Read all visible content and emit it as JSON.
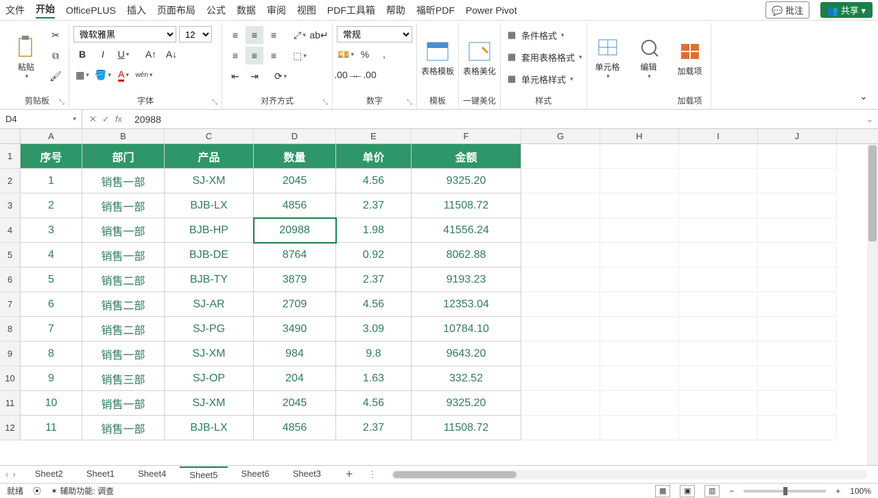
{
  "menu": {
    "items": [
      "文件",
      "开始",
      "OfficePLUS",
      "插入",
      "页面布局",
      "公式",
      "数据",
      "审阅",
      "视图",
      "PDF工具箱",
      "帮助",
      "福昕PDF",
      "Power Pivot"
    ],
    "active": "开始",
    "annotate": "批注",
    "share": "共享"
  },
  "ribbon": {
    "clipboard": {
      "paste": "粘贴",
      "label": "剪贴板"
    },
    "font": {
      "name": "微软雅黑",
      "size": "12",
      "label": "字体"
    },
    "align": {
      "label": "对齐方式"
    },
    "number": {
      "format": "常规",
      "label": "数字"
    },
    "template": {
      "btn": "表格模板",
      "label": "模板"
    },
    "beautify": {
      "btn": "表格美化",
      "label": "一键美化"
    },
    "styles": {
      "cond": "条件格式",
      "table": "套用表格格式",
      "cell": "单元格样式",
      "label": "样式"
    },
    "cells": {
      "btn": "单元格"
    },
    "edit": {
      "btn": "编辑"
    },
    "addins": {
      "btn": "加载项",
      "label": "加载项"
    }
  },
  "formula_bar": {
    "cell_ref": "D4",
    "value": "20988"
  },
  "columns": [
    "A",
    "B",
    "C",
    "D",
    "E",
    "F",
    "G",
    "H",
    "I",
    "J"
  ],
  "col_widths": [
    "cw-A",
    "cw-B",
    "cw-C",
    "cw-D",
    "cw-E",
    "cw-F",
    "cw-G",
    "cw-H",
    "cw-I",
    "cw-J"
  ],
  "header_row": [
    "序号",
    "部门",
    "产品",
    "数量",
    "单价",
    "金额"
  ],
  "selected": {
    "row": 3,
    "col": 3
  },
  "data_rows": [
    [
      "1",
      "销售一部",
      "SJ-XM",
      "2045",
      "4.56",
      "9325.20"
    ],
    [
      "2",
      "销售一部",
      "BJB-LX",
      "4856",
      "2.37",
      "11508.72"
    ],
    [
      "3",
      "销售一部",
      "BJB-HP",
      "20988",
      "1.98",
      "41556.24"
    ],
    [
      "4",
      "销售一部",
      "BJB-DE",
      "8764",
      "0.92",
      "8062.88"
    ],
    [
      "5",
      "销售二部",
      "BJB-TY",
      "3879",
      "2.37",
      "9193.23"
    ],
    [
      "6",
      "销售二部",
      "SJ-AR",
      "2709",
      "4.56",
      "12353.04"
    ],
    [
      "7",
      "销售二部",
      "SJ-PG",
      "3490",
      "3.09",
      "10784.10"
    ],
    [
      "8",
      "销售一部",
      "SJ-XM",
      "984",
      "9.8",
      "9643.20"
    ],
    [
      "9",
      "销售三部",
      "SJ-OP",
      "204",
      "1.63",
      "332.52"
    ],
    [
      "10",
      "销售一部",
      "SJ-XM",
      "2045",
      "4.56",
      "9325.20"
    ],
    [
      "11",
      "销售一部",
      "BJB-LX",
      "4856",
      "2.37",
      "11508.72"
    ]
  ],
  "sheets": {
    "tabs": [
      "Sheet2",
      "Sheet1",
      "Sheet4",
      "Sheet5",
      "Sheet6",
      "Sheet3"
    ],
    "active": "Sheet5"
  },
  "status": {
    "ready": "就绪",
    "a11y": "辅助功能: 调查",
    "zoom": "100%"
  }
}
